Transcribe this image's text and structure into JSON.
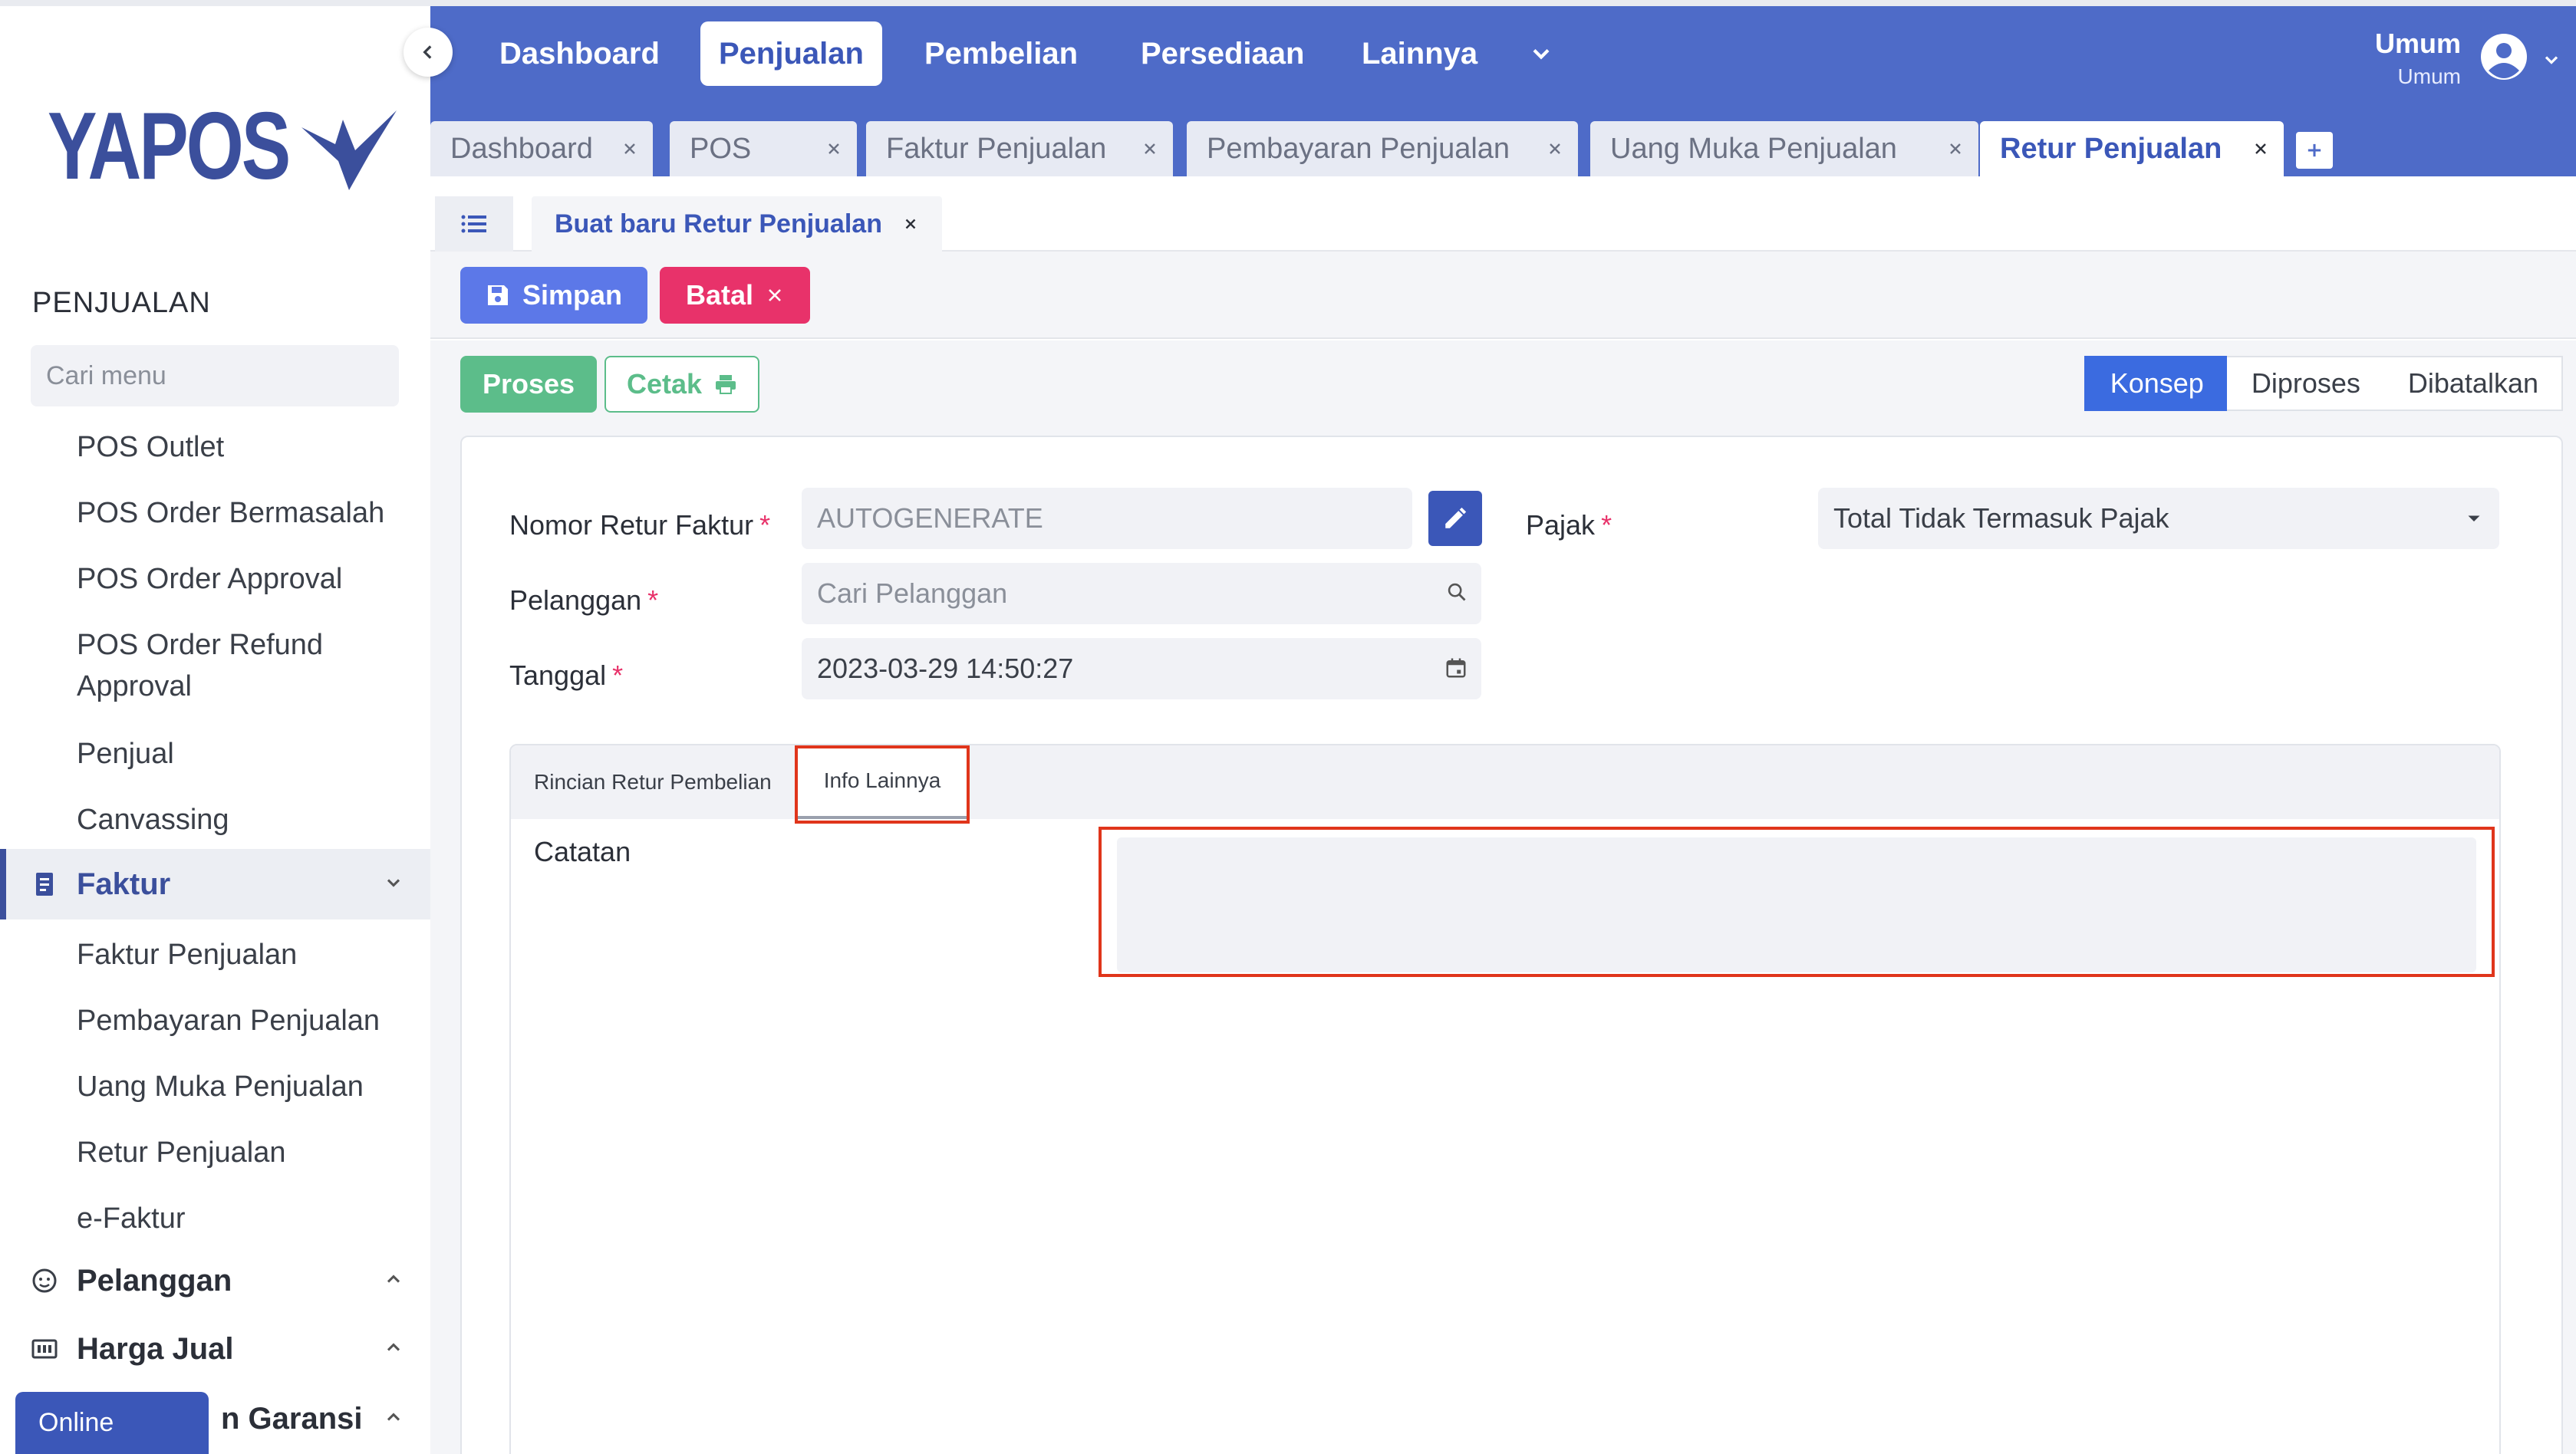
{
  "app": {
    "logo_text": "YAPOS"
  },
  "sidebar": {
    "section_title": "PENJUALAN",
    "search_placeholder": "Cari menu",
    "items": [
      {
        "label": "POS Outlet"
      },
      {
        "label": "POS Order Bermasalah"
      },
      {
        "label": "POS Order Approval"
      },
      {
        "label": "POS Order Refund Approval"
      },
      {
        "label": "Penjual"
      },
      {
        "label": "Canvassing"
      }
    ],
    "group_faktur": {
      "label": "Faktur",
      "items": [
        {
          "label": "Faktur Penjualan"
        },
        {
          "label": "Pembayaran Penjualan"
        },
        {
          "label": "Uang Muka Penjualan"
        },
        {
          "label": "Retur Penjualan"
        },
        {
          "label": "e-Faktur"
        }
      ]
    },
    "group_pelanggan": {
      "label": "Pelanggan"
    },
    "group_harga": {
      "label": "Harga Jual"
    },
    "group_garansi": {
      "label": "n Garansi"
    },
    "online_label": "Online"
  },
  "topnav": {
    "items": [
      "Dashboard",
      "Penjualan",
      "Pembelian",
      "Persediaan",
      "Lainnya"
    ],
    "active": "Penjualan",
    "user_name": "Umum",
    "user_role": "Umum"
  },
  "tabs": [
    {
      "label": "Dashboard"
    },
    {
      "label": "POS"
    },
    {
      "label": "Faktur Penjualan"
    },
    {
      "label": "Pembayaran Penjualan"
    },
    {
      "label": "Uang Muka Penjualan"
    },
    {
      "label": "Retur Penjualan",
      "active": true
    }
  ],
  "subtab": {
    "label": "Buat baru Retur Penjualan"
  },
  "actions": {
    "save_label": "Simpan",
    "cancel_label": "Batal",
    "process_label": "Proses",
    "print_label": "Cetak"
  },
  "status_steps": [
    "Konsep",
    "Diproses",
    "Dibatalkan"
  ],
  "form": {
    "nomor_label": "Nomor Retur Faktur",
    "nomor_value": "AUTOGENERATE",
    "pelanggan_label": "Pelanggan",
    "pelanggan_placeholder": "Cari Pelanggan",
    "tanggal_label": "Tanggal",
    "tanggal_value": "2023-03-29  14:50:27",
    "pajak_label": "Pajak",
    "pajak_value": "Total Tidak Termasuk Pajak",
    "required_mark": "*"
  },
  "panel": {
    "tab_rincian": "Rincian Retur Pembelian",
    "tab_info": "Info Lainnya",
    "catatan_label": "Catatan"
  },
  "colors": {
    "primary": "#4e6bc8",
    "accent_blue": "#3b57b8",
    "danger": "#e8326a",
    "success": "#5cbd8a",
    "highlight": "#e0351b"
  }
}
